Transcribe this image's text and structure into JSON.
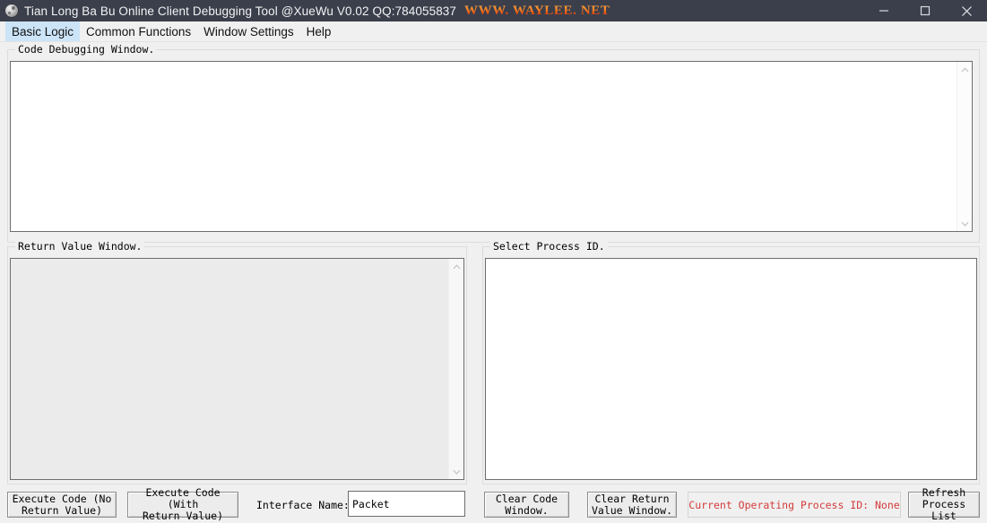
{
  "window": {
    "title": "Tian Long Ba Bu Online Client Debugging Tool @XueWu V0.02 QQ:784055837",
    "brand": "WWW. WAYLEE. NET",
    "icon": "app-globe-icon",
    "controls": {
      "minimize": "minimize-icon",
      "maximize": "maximize-icon",
      "close": "close-icon"
    },
    "titlebar_color": "#3b3f4c",
    "brand_color": "#f05a1e"
  },
  "menubar": {
    "items": [
      {
        "label": "Basic Logic",
        "active": true
      },
      {
        "label": "Common Functions",
        "active": false
      },
      {
        "label": "Window Settings",
        "active": false
      },
      {
        "label": "Help",
        "active": false
      }
    ],
    "active_highlight_color": "#cce4f7"
  },
  "groups": {
    "code_debugging": {
      "label": "Code Debugging Window.",
      "content": "",
      "scrollbar": {
        "up": "scroll-up-arrow",
        "down": "scroll-down-arrow"
      }
    },
    "return_value": {
      "label": "Return Value Window.",
      "content": "",
      "disabled": true,
      "scrollbar": {
        "up": "scroll-up-arrow",
        "down": "scroll-down-arrow"
      }
    },
    "select_process": {
      "label": "Select Process ID.",
      "content": ""
    }
  },
  "bottom": {
    "execute_no_return": "Execute Code (No\nReturn Value)",
    "execute_with_return": "Execute Code (With\nReturn Value)",
    "interface_name_label": "Interface Name:",
    "interface_name_value": "Packet",
    "interface_name_placeholder": "",
    "clear_code_window": "Clear Code\nWindow.",
    "clear_return_value_window": "Clear Return\nValue Window.",
    "status": "Current Operating Process ID: None",
    "status_color": "#d23b3b",
    "refresh_process_list": "Refresh\nProcess List"
  }
}
